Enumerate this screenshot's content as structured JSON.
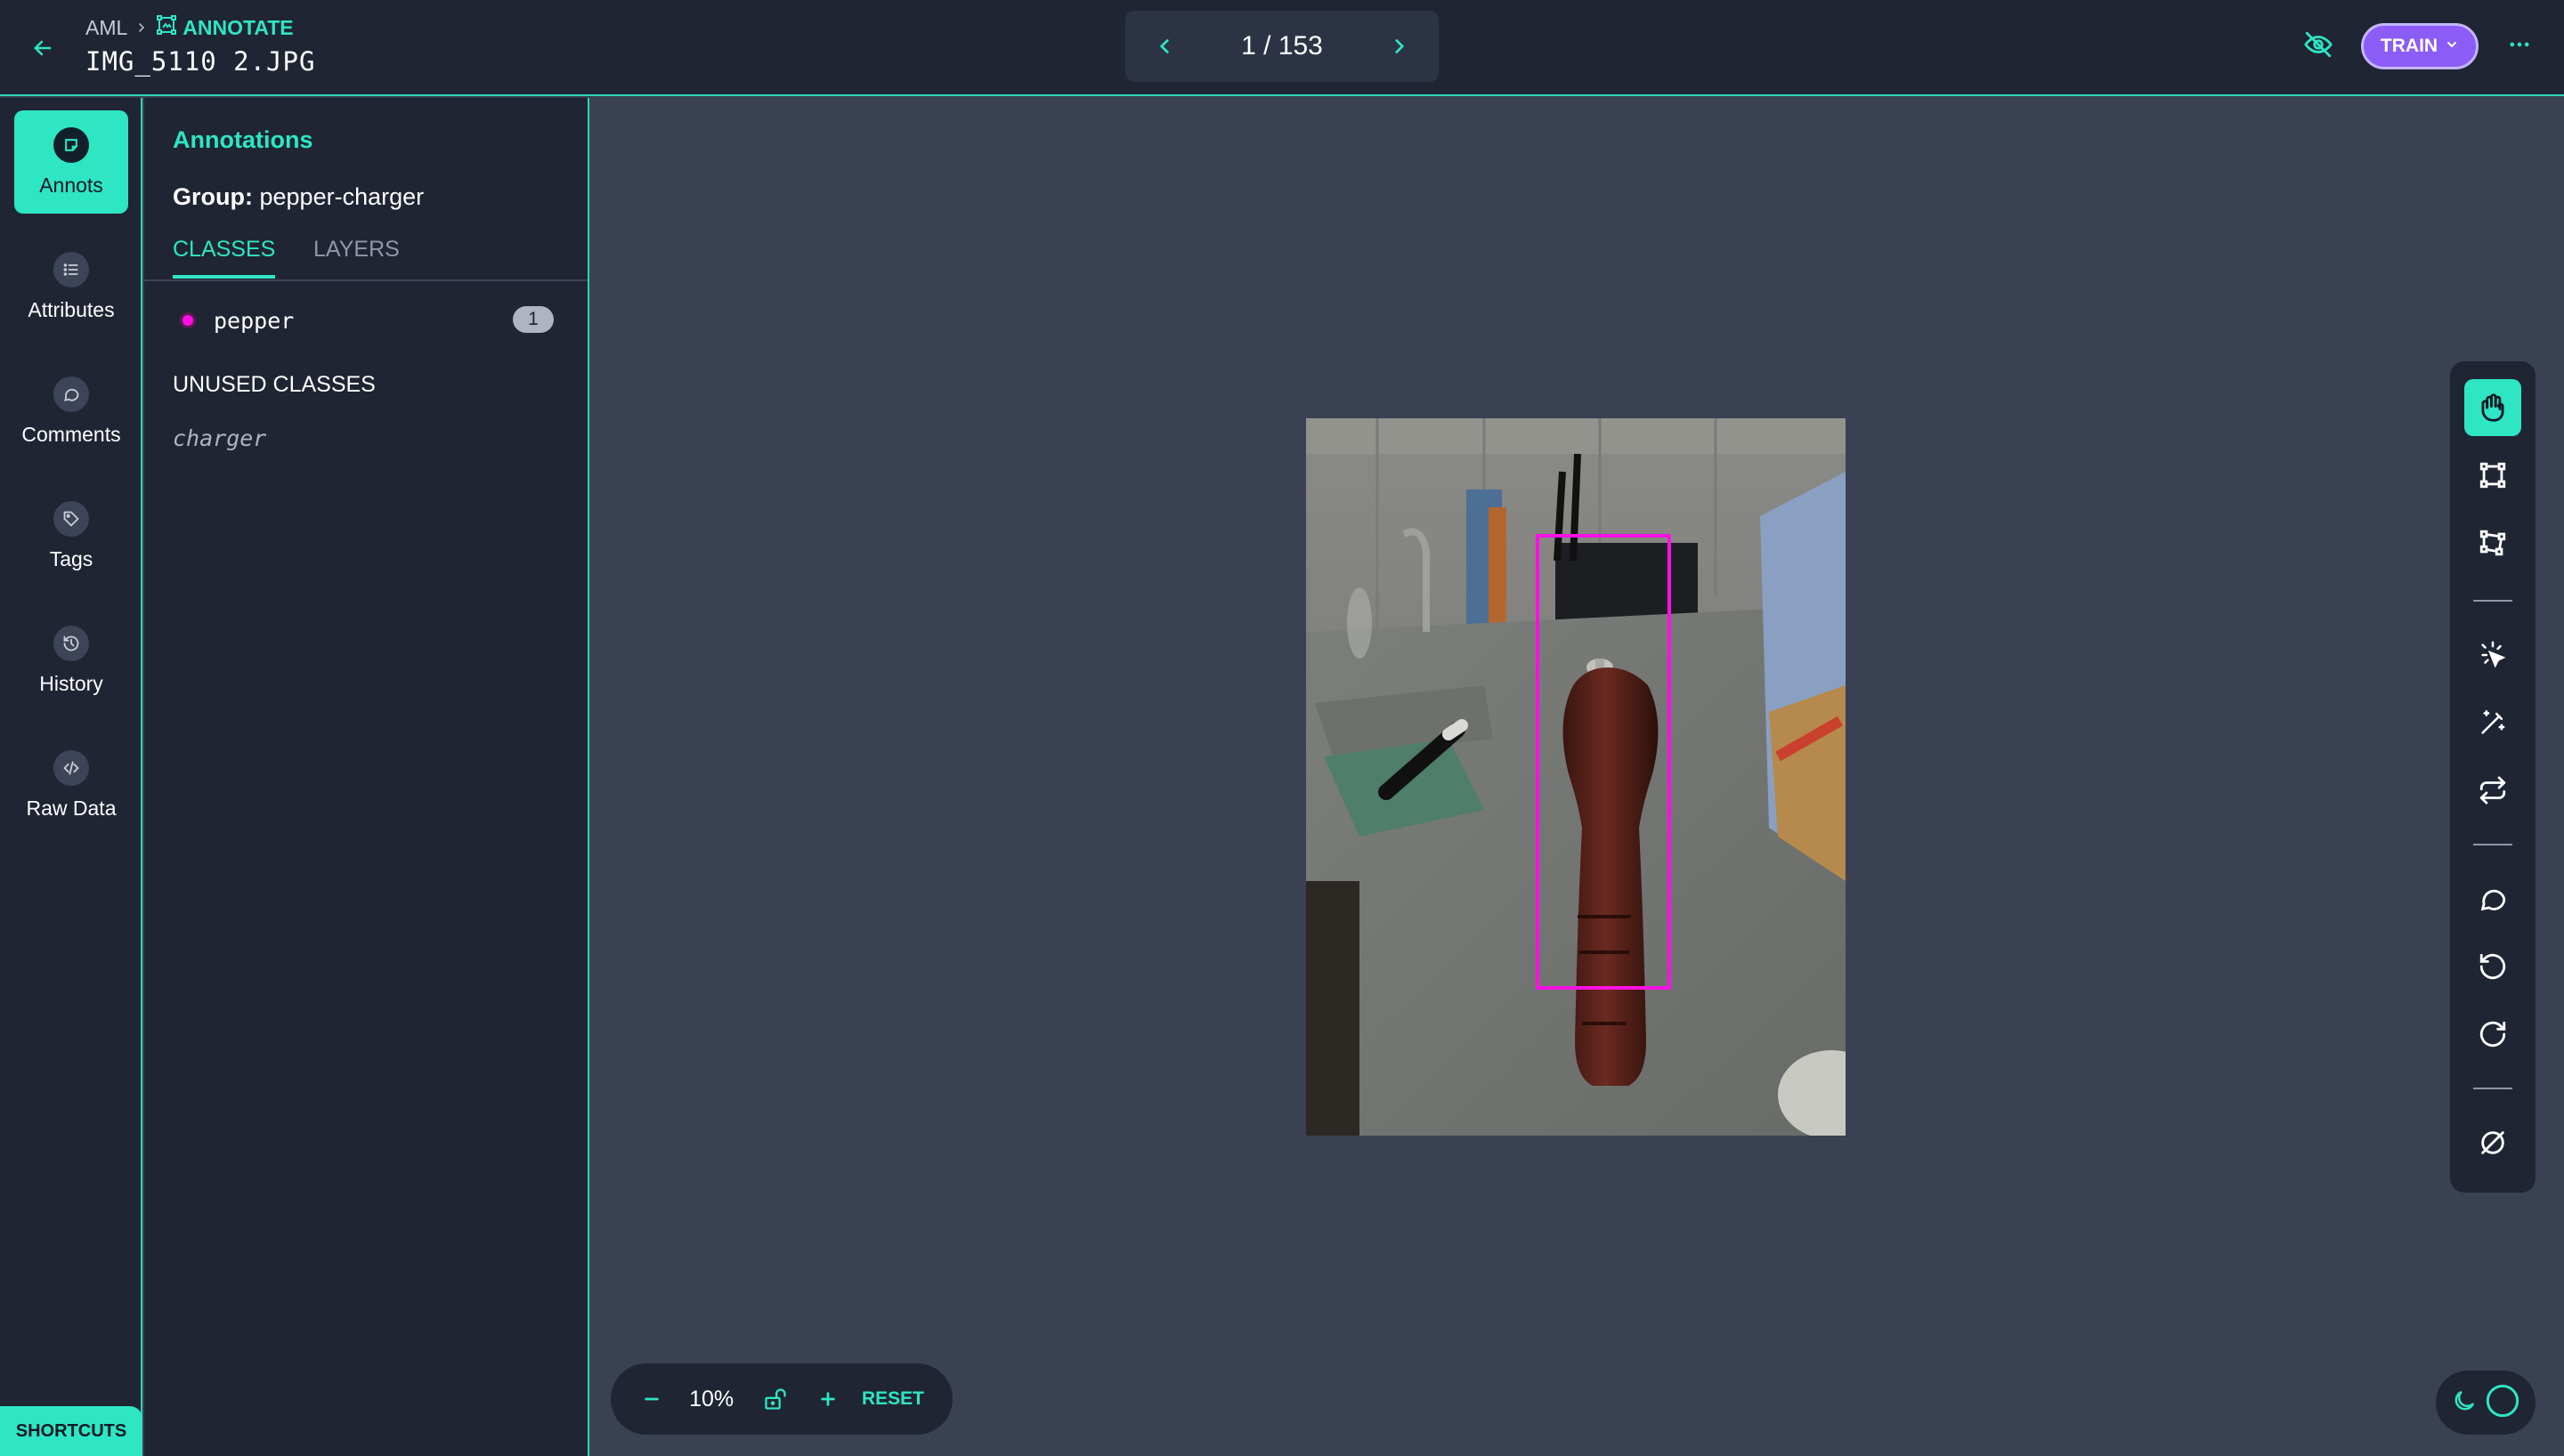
{
  "header": {
    "breadcrumb_root": "AML",
    "breadcrumb_current": "ANNOTATE",
    "file_title": "IMG_5110 2.JPG",
    "pager": {
      "current": 1,
      "total": 153,
      "label": "1 / 153"
    },
    "train_label": "TRAIN"
  },
  "nav": {
    "items": [
      {
        "label": "Annots",
        "icon": "annotation-icon",
        "active": true
      },
      {
        "label": "Attributes",
        "icon": "list-icon",
        "active": false
      },
      {
        "label": "Comments",
        "icon": "comment-icon",
        "active": false
      },
      {
        "label": "Tags",
        "icon": "tag-icon",
        "active": false
      },
      {
        "label": "History",
        "icon": "history-icon",
        "active": false
      },
      {
        "label": "Raw Data",
        "icon": "code-icon",
        "active": false
      }
    ],
    "shortcuts_label": "SHORTCUTS"
  },
  "panel": {
    "title": "Annotations",
    "group_label": "Group:",
    "group_value": "pepper-charger",
    "tabs": [
      {
        "label": "CLASSES",
        "active": true
      },
      {
        "label": "LAYERS",
        "active": false
      }
    ],
    "classes": [
      {
        "name": "pepper",
        "count": "1",
        "color": "#ff10e4"
      }
    ],
    "unused_title": "UNUSED CLASSES",
    "unused_classes": [
      "charger"
    ]
  },
  "zoom": {
    "level": "10%",
    "reset_label": "RESET"
  },
  "toolbar": {
    "tools": [
      "hand-icon",
      "bounding-box-icon",
      "polygon-icon",
      "magic-select-icon",
      "magic-wand-icon",
      "swap-icon",
      "comment-icon",
      "undo-icon",
      "redo-icon",
      "clear-icon"
    ]
  },
  "colors": {
    "accent": "#2ee5c4",
    "train": "#8b5cf6",
    "annotation": "#ff10e4",
    "panel_bg": "#1f2533",
    "canvas_bg": "#3a4152"
  }
}
